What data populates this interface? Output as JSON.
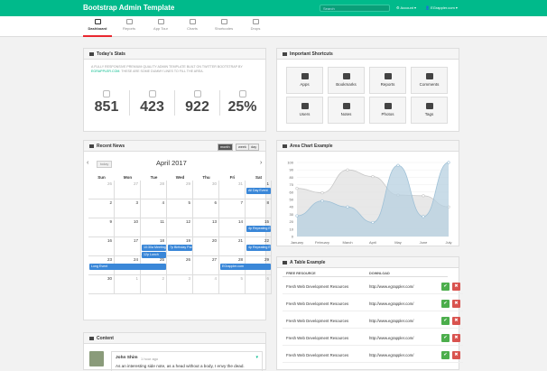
{
  "topbar": {
    "brand": "Bootstrap Admin Template",
    "search_placeholder": "Search",
    "account_label": "Account",
    "user_label": "EGrappler.com"
  },
  "nav": [
    {
      "label": "Dashboard",
      "icon": "dashboard-icon",
      "active": true
    },
    {
      "label": "Reports",
      "icon": "reports-icon"
    },
    {
      "label": "App Tour",
      "icon": "app-tour-icon"
    },
    {
      "label": "Charts",
      "icon": "charts-icon"
    },
    {
      "label": "Shortcodes",
      "icon": "shortcodes-icon"
    },
    {
      "label": "Drops",
      "icon": "drops-icon"
    }
  ],
  "stats": {
    "title": "Today's Stats",
    "desc_part1": "A fully responsive premium quality admin template built on Twitter Bootstrap by",
    "desc_link": "EGrappler.com",
    "desc_part2": ". These are some dummy lines to fill the area.",
    "items": [
      {
        "icon": "anchor-icon",
        "value": "851"
      },
      {
        "icon": "thumbs-up-icon",
        "value": "423"
      },
      {
        "icon": "twitter-icon",
        "value": "922"
      },
      {
        "icon": "bullhorn-icon",
        "value": "25%"
      }
    ]
  },
  "shortcuts": {
    "title": "Important Shortcuts",
    "items": [
      {
        "label": "Apps",
        "icon": "apps-icon"
      },
      {
        "label": "Bookmarks",
        "icon": "bookmark-icon"
      },
      {
        "label": "Reports",
        "icon": "signal-icon"
      },
      {
        "label": "Comments",
        "icon": "comment-icon"
      },
      {
        "label": "Users",
        "icon": "users-icon"
      },
      {
        "label": "Notes",
        "icon": "file-icon"
      },
      {
        "label": "Photos",
        "icon": "picture-icon"
      },
      {
        "label": "Tags",
        "icon": "tag-icon"
      }
    ]
  },
  "news": {
    "title": "Recent News",
    "prev": "‹",
    "next": "›",
    "today": "today",
    "month_title": "April 2017",
    "views": [
      "month",
      "week",
      "day"
    ],
    "active_view": "month",
    "dow": [
      "Sun",
      "Mon",
      "Tue",
      "Wed",
      "Thu",
      "Fri",
      "Sat"
    ],
    "weeks": [
      [
        {
          "d": "26",
          "o": true
        },
        {
          "d": "27",
          "o": true
        },
        {
          "d": "28",
          "o": true
        },
        {
          "d": "29",
          "o": true
        },
        {
          "d": "30",
          "o": true
        },
        {
          "d": "31",
          "o": true
        },
        {
          "d": "1"
        }
      ],
      [
        {
          "d": "2"
        },
        {
          "d": "3"
        },
        {
          "d": "4"
        },
        {
          "d": "5"
        },
        {
          "d": "6"
        },
        {
          "d": "7"
        },
        {
          "d": "8"
        }
      ],
      [
        {
          "d": "9"
        },
        {
          "d": "10"
        },
        {
          "d": "11"
        },
        {
          "d": "12"
        },
        {
          "d": "13"
        },
        {
          "d": "14"
        },
        {
          "d": "15"
        }
      ],
      [
        {
          "d": "16"
        },
        {
          "d": "17"
        },
        {
          "d": "18"
        },
        {
          "d": "19"
        },
        {
          "d": "20"
        },
        {
          "d": "21"
        },
        {
          "d": "22"
        }
      ],
      [
        {
          "d": "23"
        },
        {
          "d": "24"
        },
        {
          "d": "25"
        },
        {
          "d": "26"
        },
        {
          "d": "27"
        },
        {
          "d": "28"
        },
        {
          "d": "29"
        }
      ],
      [
        {
          "d": "30"
        },
        {
          "d": "1",
          "o": true
        },
        {
          "d": "2",
          "o": true
        },
        {
          "d": "3",
          "o": true
        },
        {
          "d": "4",
          "o": true
        },
        {
          "d": "5",
          "o": true
        },
        {
          "d": "6",
          "o": true
        }
      ]
    ],
    "events": [
      {
        "label": "All Day Event",
        "week": 0,
        "start": 6,
        "span": 1,
        "line": 0
      },
      {
        "label": "4p Repeating Event",
        "week": 2,
        "start": 6,
        "span": 1,
        "line": 0
      },
      {
        "label": "10:30a Meeting",
        "week": 3,
        "start": 2,
        "span": 1,
        "line": 0
      },
      {
        "label": "12p Lunch",
        "week": 3,
        "start": 2,
        "span": 1,
        "line": 1
      },
      {
        "label": "7p Birthday Party",
        "week": 3,
        "start": 3,
        "span": 1,
        "line": 0
      },
      {
        "label": "4p Repeating Event",
        "week": 3,
        "start": 6,
        "span": 1,
        "line": 0
      },
      {
        "label": "Long Event",
        "week": 4,
        "start": 0,
        "span": 3,
        "line": 0
      },
      {
        "label": "EGrappler.com",
        "week": 4,
        "start": 5,
        "span": 2,
        "line": 0
      }
    ]
  },
  "area_chart": {
    "title": "Area Chart Example"
  },
  "chart_data": {
    "type": "area",
    "title": "",
    "categories": [
      "January",
      "February",
      "March",
      "April",
      "May",
      "June",
      "July"
    ],
    "ylim": [
      0,
      100
    ],
    "yticks": [
      0,
      10,
      20,
      30,
      40,
      50,
      60,
      70,
      80,
      90,
      100
    ],
    "series": [
      {
        "values": [
          65,
          59,
          90,
          81,
          56,
          55,
          40
        ],
        "fill": "#e0e0e0",
        "stroke": "#c8c8c8"
      },
      {
        "values": [
          28,
          48,
          40,
          19,
          96,
          27,
          100
        ],
        "fill": "#b7d0e0",
        "stroke": "#9ec0d6"
      }
    ]
  },
  "table": {
    "title": "A Table Example",
    "headers": [
      "FREE RESOURCE",
      "DOWNLOAD"
    ],
    "rows": [
      {
        "resource": "Fresh Web Development Resources",
        "url": "http://www.egrappler.com/"
      },
      {
        "resource": "Fresh Web Development Resources",
        "url": "http://www.egrappler.com/"
      },
      {
        "resource": "Fresh Web Development Resources",
        "url": "http://www.egrappler.com/"
      },
      {
        "resource": "Fresh Web Development Resources",
        "url": "http://www.egrappler.com/"
      },
      {
        "resource": "Fresh Web Development Resources",
        "url": "http://www.egrappler.com/"
      }
    ],
    "ok": "✔",
    "del": "✖"
  },
  "content": {
    "title": "Content",
    "author": "John Shim",
    "time": "1 hour ago",
    "text": "As an interesting side note, as a head without a body, I envy the dead."
  }
}
